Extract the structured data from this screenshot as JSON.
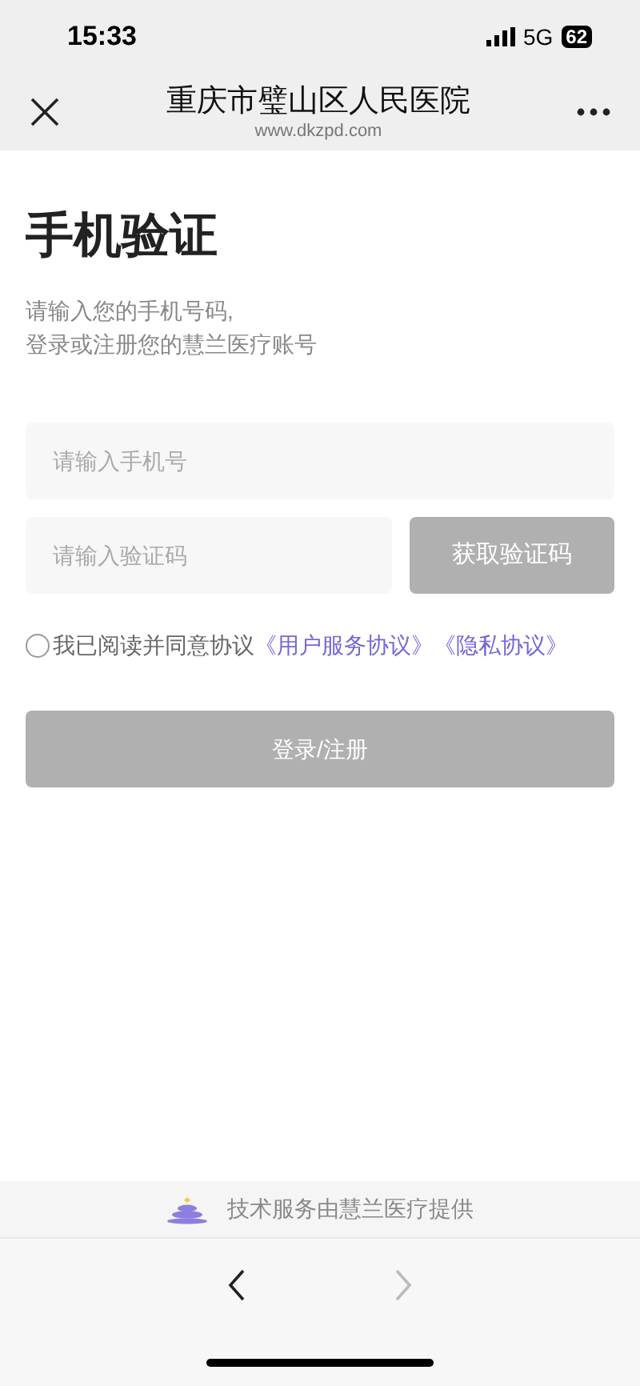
{
  "status_bar": {
    "time": "15:33",
    "network": "5G",
    "battery": "62"
  },
  "nav": {
    "title": "重庆市璧山区人民医院",
    "subtitle": "www.dkzpd.com"
  },
  "heading": "手机验证",
  "intro": [
    "请输入您的手机号码,",
    "登录或注册您的慧兰医疗账号"
  ],
  "phone_field": {
    "placeholder": "请输入手机号"
  },
  "code_field": {
    "placeholder": "请输入验证码"
  },
  "get_code_button": {
    "label": "获取验证码",
    "disabled": true
  },
  "agreement": {
    "checked": false,
    "text": "我已阅读并同意协议",
    "links": [
      "《用户服务协议》",
      "《隐私协议》"
    ]
  },
  "submit_button": {
    "label": "登录/注册",
    "disabled": true
  },
  "footer": {
    "text": "技术服务由慧兰医疗提供"
  },
  "toolbar": {
    "back": {
      "disabled": false
    },
    "forward": {
      "disabled": true
    }
  }
}
